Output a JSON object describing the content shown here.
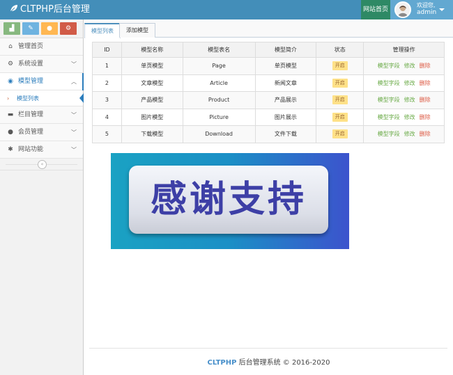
{
  "header": {
    "brand": "CLTPHP后台管理",
    "site_home": "网站首页",
    "welcome": "欢迎您,",
    "username": "admin"
  },
  "shortcuts": [
    {
      "icon": "signal-icon",
      "glyph": "▟",
      "color": "#87b87f"
    },
    {
      "icon": "pencil-icon",
      "glyph": "✎",
      "color": "#6fb3e0"
    },
    {
      "icon": "users-icon",
      "glyph": "●",
      "color": "#ffb752"
    },
    {
      "icon": "cogs-icon",
      "glyph": "⚙",
      "color": "#d15b47"
    }
  ],
  "sidebar": {
    "items": [
      {
        "label": "管理首页",
        "icon": "home-icon",
        "glyph": "⌂"
      },
      {
        "label": "系统设置",
        "icon": "cogs-icon",
        "glyph": "⚙"
      },
      {
        "label": "模型管理",
        "icon": "globe-icon",
        "glyph": "◉"
      },
      {
        "label": "栏目管理",
        "icon": "folder-icon",
        "glyph": "▬"
      },
      {
        "label": "会员管理",
        "icon": "users-icon",
        "glyph": "●"
      },
      {
        "label": "网站功能",
        "icon": "gear-icon",
        "glyph": "✱"
      }
    ],
    "sub_item": "模型列表",
    "collapse_glyph": "«"
  },
  "tabs": [
    "模型列表",
    "添加模型"
  ],
  "table": {
    "headers": [
      "ID",
      "模型名称",
      "模型表名",
      "模型简介",
      "状态",
      "管理操作"
    ],
    "rows": [
      {
        "id": "1",
        "name": "单页模型",
        "table": "Page",
        "intro": "单页模型",
        "status": "开启"
      },
      {
        "id": "2",
        "name": "文章模型",
        "table": "Article",
        "intro": "新闻文章",
        "status": "开启"
      },
      {
        "id": "3",
        "name": "产品模型",
        "table": "Product",
        "intro": "产品展示",
        "status": "开启"
      },
      {
        "id": "4",
        "name": "图片模型",
        "table": "Picture",
        "intro": "图片展示",
        "status": "开启"
      },
      {
        "id": "5",
        "name": "下载模型",
        "table": "Download",
        "intro": "文件下载",
        "status": "开启"
      }
    ],
    "actions": [
      "模型字段",
      "修改",
      "删除"
    ]
  },
  "banner_text": "感谢支持",
  "footer": {
    "brand": "CLTPHP",
    "text": " 后台管理系统 © 2016-2020"
  }
}
